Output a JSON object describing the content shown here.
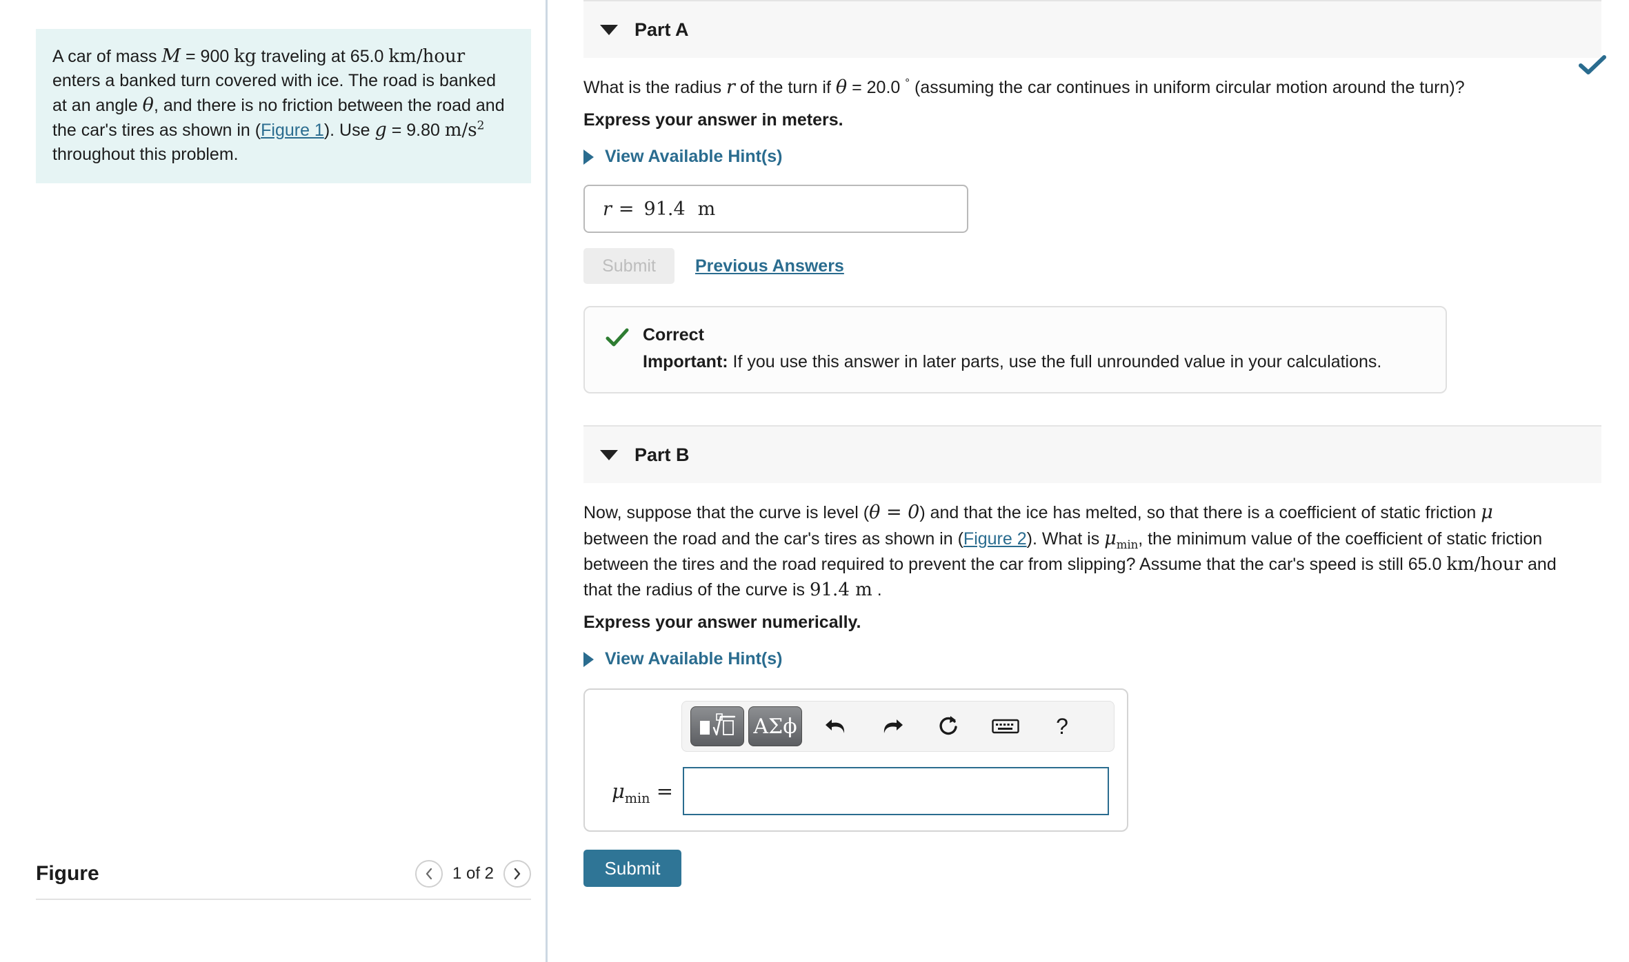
{
  "problem": {
    "text_segments": [
      "A car of mass ",
      "M",
      " = 900 ",
      "kg",
      " traveling at 65.0 ",
      "km/hour",
      " enters a banked turn covered with ice. The road is banked at an angle ",
      "θ",
      ", and there is no friction between the road and the car's tires as shown in (",
      "Figure 1",
      "). Use ",
      "g",
      " = 9.80 ",
      "m/s",
      "2",
      " throughout this problem."
    ],
    "mass_symbol": "M",
    "mass_value": "900 kg",
    "speed": "65.0 km/hour",
    "angle_symbol": "θ",
    "figure_link": "Figure 1",
    "gravity_symbol": "g",
    "gravity_value": "9.80 m/s",
    "gravity_exponent": "2"
  },
  "figure_panel": {
    "title": "Figure",
    "prev_icon": "chevron-left-icon",
    "next_icon": "chevron-right-icon",
    "counter": "1 of 2"
  },
  "parts": {
    "a": {
      "title": "Part A",
      "caret_icon": "caret-down-icon",
      "status_icon": "check-icon",
      "question_pre": "What is the radius ",
      "question_symbol": "r",
      "question_mid": " of the turn if ",
      "question_theta": "θ",
      "question_angle": " = 20.0 ",
      "question_deg": "°",
      "question_post": " (assuming the car continues in uniform circular motion around the turn)?",
      "express": "Express your answer in meters.",
      "hint_label": "View Available Hint(s)",
      "hint_caret_icon": "caret-right-icon",
      "answer_label": "r",
      "answer_equals": "=",
      "answer_value": "91.4",
      "answer_unit": "m",
      "submit_label": "Submit",
      "previous_answers_label": "Previous Answers",
      "feedback": {
        "icon": "check-icon",
        "title": "Correct",
        "important_label": "Important:",
        "body": " If you use this answer in later parts, use the full unrounded value in your calculations."
      }
    },
    "b": {
      "title": "Part B",
      "caret_icon": "caret-down-icon",
      "q_1": "Now, suppose that the curve is level (",
      "q_theta": "θ = 0",
      "q_2": ") and that the ice has melted, so that there is a coefficient of static friction ",
      "q_mu": "μ",
      "q_3": " between the road and the car's tires as shown in (",
      "q_figlink": "Figure 2",
      "q_4": "). What is ",
      "q_mumin": "μ",
      "q_mumin_sub": "min",
      "q_5": ", the minimum value of the coefficient of static friction between the tires and the road required to prevent the car from slipping? Assume that the car's speed is still 65.0 ",
      "q_kmh": "km/hour",
      "q_6": " and that the radius of the curve is ",
      "q_radius": "91.4 m",
      "q_7": " .",
      "express": "Express your answer numerically.",
      "hint_label": "View Available Hint(s)",
      "hint_caret_icon": "caret-right-icon",
      "toolbar": {
        "template_button": "template-math-icon",
        "greek_button": "ΑΣϕ",
        "undo_icon": "undo-arrow-icon",
        "redo_icon": "redo-arrow-icon",
        "reset_icon": "reset-circular-arrow-icon",
        "keyboard_icon": "keyboard-icon",
        "help_icon": "?"
      },
      "answer_label_mu": "μ",
      "answer_label_sub": "min",
      "answer_equals": "=",
      "answer_value": "",
      "answer_placeholder": "",
      "submit_label": "Submit"
    }
  },
  "colors": {
    "accent": "#2a6c8f",
    "submit": "#2f7596",
    "problem_bg": "#e6f4f4",
    "header_bg": "#f7f7f7",
    "correct_check": "#2e7d32",
    "status_check": "#2a6c8f"
  }
}
